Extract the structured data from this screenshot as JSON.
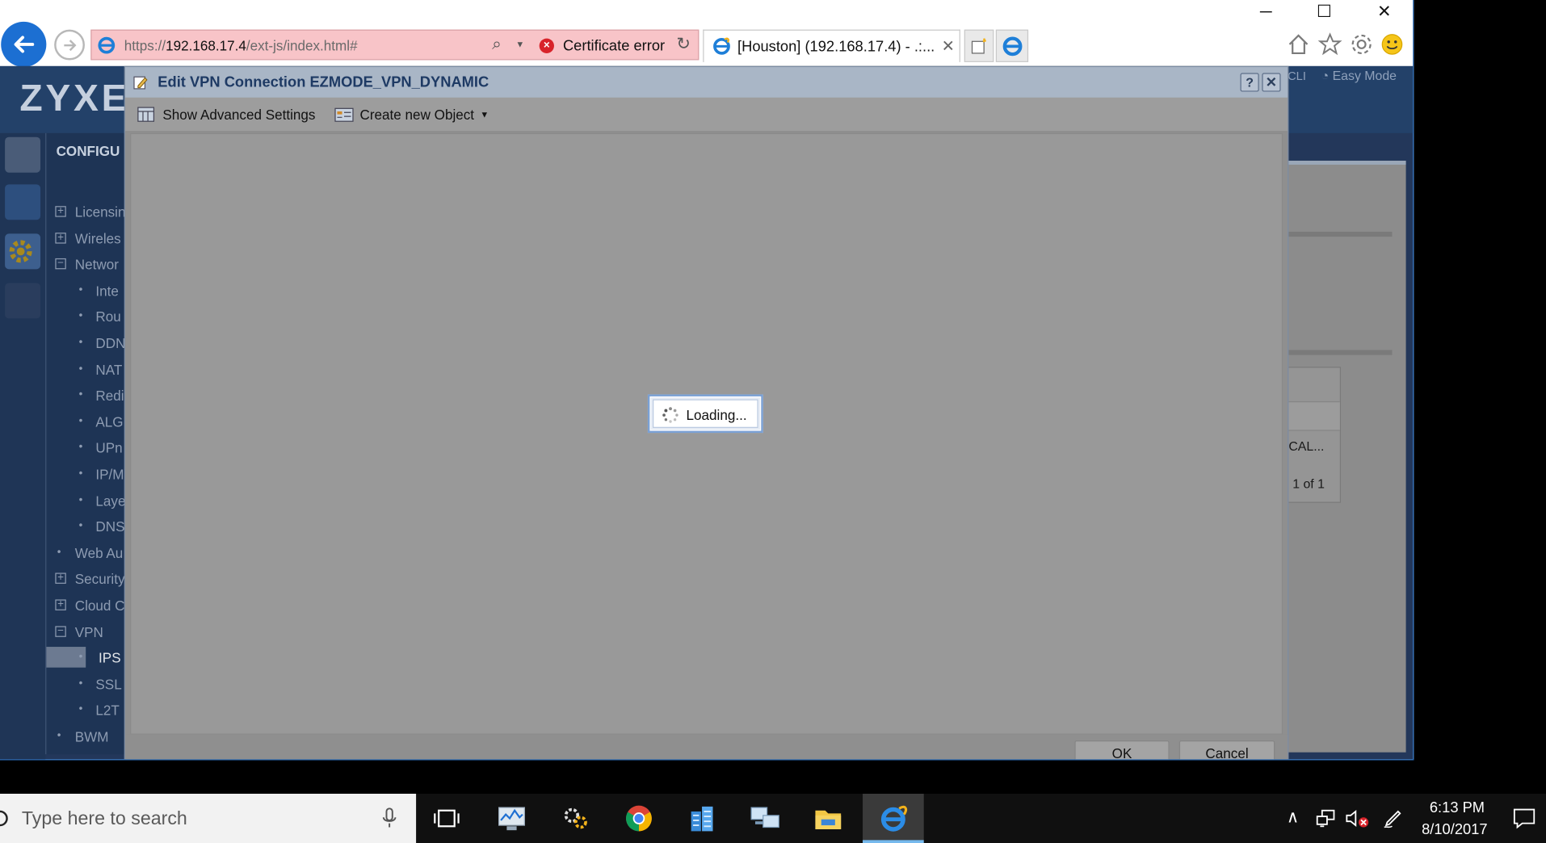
{
  "browser": {
    "address_prefix": "https://",
    "address_host": "192.168.17.4",
    "address_path": "/ext-js/index.html#",
    "cert_error": "Certificate error",
    "tab_title": "[Houston] (192.168.17.4) - .:...",
    "tab_close": "✕",
    "window_controls": {
      "minimize": "─",
      "maximize": "☐",
      "close": "✕"
    }
  },
  "page": {
    "logo": "ZYXE",
    "cli": "CLI",
    "easy_mode": "Easy Mode",
    "nav_title": "CONFIGU",
    "nav_items": [
      {
        "label": "Licensin",
        "kind": "group",
        "state": "+"
      },
      {
        "label": "Wireles",
        "kind": "group",
        "state": "+"
      },
      {
        "label": "Networ",
        "kind": "group",
        "state": "−"
      },
      {
        "label": "Inte",
        "kind": "sub"
      },
      {
        "label": "Rou",
        "kind": "sub"
      },
      {
        "label": "DDN",
        "kind": "sub"
      },
      {
        "label": "NAT",
        "kind": "sub"
      },
      {
        "label": "Redi",
        "kind": "sub"
      },
      {
        "label": "ALG",
        "kind": "sub"
      },
      {
        "label": "UPn",
        "kind": "sub"
      },
      {
        "label": "IP/M",
        "kind": "sub"
      },
      {
        "label": "Laye",
        "kind": "sub"
      },
      {
        "label": "DNS",
        "kind": "sub"
      },
      {
        "label": "Web Au",
        "kind": "leaf"
      },
      {
        "label": "Security",
        "kind": "group",
        "state": "+"
      },
      {
        "label": "Cloud C",
        "kind": "group",
        "state": "+"
      },
      {
        "label": "VPN",
        "kind": "group",
        "state": "−"
      },
      {
        "label": "IPS",
        "kind": "sub"
      },
      {
        "label": "SSL",
        "kind": "sub"
      },
      {
        "label": "L2T",
        "kind": "sub"
      },
      {
        "label": "BWM",
        "kind": "leaf"
      }
    ],
    "right_cell": "CAL...",
    "right_pager": "1 of 1"
  },
  "dialog": {
    "title": "Edit VPN Connection EZMODE_VPN_DYNAMIC",
    "help": "?",
    "close": "✕",
    "toolbar": {
      "advanced": "Show Advanced Settings",
      "create_object": "Create new Object"
    },
    "loading": "Loading...",
    "ok": "OK",
    "cancel": "Cancel"
  },
  "taskbar": {
    "search_placeholder": "Type here to search",
    "time": "6:13 PM",
    "date": "8/10/2017"
  },
  "colors": {
    "back_button": "#1c6fd2",
    "cert_error_bg": "#f8c4c8",
    "dialog_title": "#1e3a64"
  }
}
